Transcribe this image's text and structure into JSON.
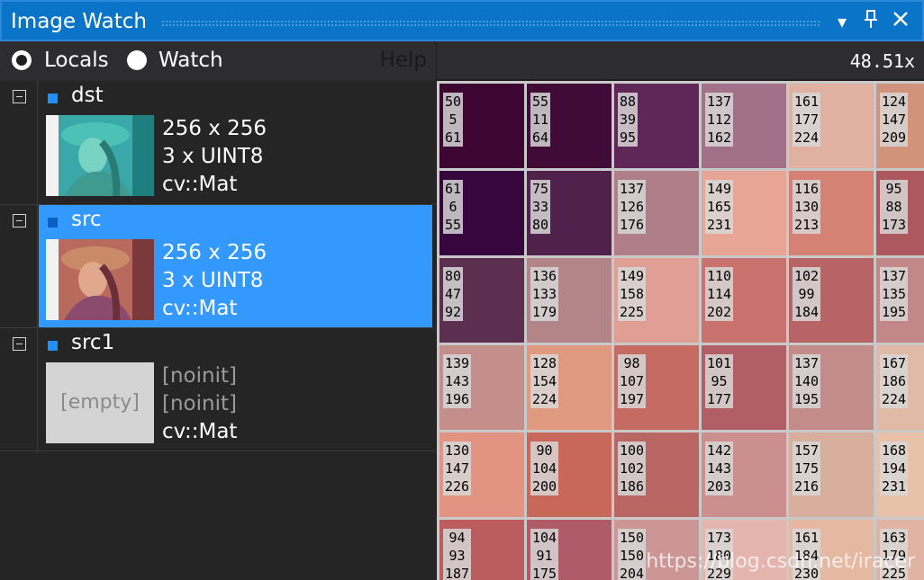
{
  "window": {
    "title": "Image Watch"
  },
  "toolbar": {
    "locals_label": "Locals",
    "watch_label": "Watch",
    "help_label": "Help",
    "selected": "Locals"
  },
  "variables": [
    {
      "name": "dst",
      "size": "256 x 256",
      "type": "3 x UINT8",
      "class": "cv::Mat",
      "selected": false,
      "thumbnail": "teal-tinted portrait"
    },
    {
      "name": "src",
      "size": "256 x 256",
      "type": "3 x UINT8",
      "class": "cv::Mat",
      "selected": true,
      "thumbnail": "portrait"
    },
    {
      "name": "src1",
      "size": "[noinit]",
      "type": "[noinit]",
      "class": "cv::Mat",
      "selected": false,
      "empty_label": "[empty]"
    }
  ],
  "viewer": {
    "zoom": "48.51x",
    "pixels": [
      [
        [
          "50",
          "5",
          "61"
        ],
        [
          "55",
          "11",
          "64"
        ],
        [
          "88",
          "39",
          "95"
        ],
        [
          "137",
          "112",
          "162"
        ],
        [
          "161",
          "177",
          "224"
        ],
        [
          "124",
          "147",
          "209"
        ]
      ],
      [
        [
          "61",
          "6",
          "55"
        ],
        [
          "75",
          "33",
          "80"
        ],
        [
          "137",
          "126",
          "176"
        ],
        [
          "149",
          "165",
          "231"
        ],
        [
          "116",
          "130",
          "213"
        ],
        [
          "95",
          "88",
          "173"
        ]
      ],
      [
        [
          "80",
          "47",
          "92"
        ],
        [
          "136",
          "133",
          "179"
        ],
        [
          "149",
          "158",
          "225"
        ],
        [
          "110",
          "114",
          "202"
        ],
        [
          "102",
          "99",
          "184"
        ],
        [
          "137",
          "135",
          "195"
        ]
      ],
      [
        [
          "139",
          "143",
          "196"
        ],
        [
          "128",
          "154",
          "224"
        ],
        [
          "98",
          "107",
          "197"
        ],
        [
          "101",
          "95",
          "177"
        ],
        [
          "137",
          "140",
          "195"
        ],
        [
          "167",
          "186",
          "224"
        ]
      ],
      [
        [
          "130",
          "147",
          "226"
        ],
        [
          "90",
          "104",
          "200"
        ],
        [
          "100",
          "102",
          "186"
        ],
        [
          "142",
          "143",
          "203"
        ],
        [
          "157",
          "175",
          "216"
        ],
        [
          "168",
          "194",
          "231"
        ]
      ],
      [
        [
          "94",
          "93",
          "187"
        ],
        [
          "104",
          "91",
          "175"
        ],
        [
          "150",
          "150",
          "204"
        ],
        [
          "173",
          "180",
          "229"
        ],
        [
          "161",
          "184",
          "230"
        ],
        [
          "163",
          "179",
          "225"
        ]
      ]
    ]
  },
  "watermark": "https://blog.csdn.net/iracer",
  "colors": {
    "accent": "#0a74c8",
    "selection": "#3399ff"
  }
}
